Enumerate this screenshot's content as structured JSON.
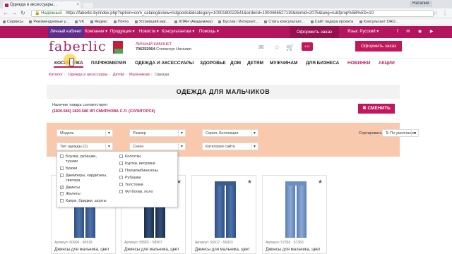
{
  "browser": {
    "tab_title": "Одежда и аксессуары...",
    "window_label": "Наталия",
    "security_label": "Надежный",
    "url": "https://faberlic.by/index.php?option=com_catalog&view=listgoods&idcategory=1000180022541&orderid=1000466527119&itemid=2075&lang=ru&fprop%5B%5D=10",
    "bookmarks": [
      "Сервисы",
      "Рекомендуемые у...",
      "VK",
      "Яндекс",
      "Почта",
      "Устревший маг...",
      "КЛАН (Академика)",
      "Буслик / Интернет...",
      "Стать консультант...",
      "Сайт лидера проекта",
      "Консультант ОАО..."
    ]
  },
  "topbar": {
    "items": [
      "Личный кабинет",
      "Компания ▾",
      "Продукция ▾",
      "Новости ▾",
      "Консультантам ▾",
      "Помощь ▾"
    ],
    "order_label": "Оформить заказ",
    "lang_label": "Язык: Русский ▾",
    "socials": "f ✉ ◉ ▶"
  },
  "header": {
    "logo": "faberlic",
    "cabinet_label": "ЛИЧНЫЙ КАБИНЕТ",
    "user_id": "706252064",
    "user_name": "Степанчук Наталия",
    "price_badge": "4,91",
    "order_button": "Оформить заказ"
  },
  "categories": [
    "КОСМЕТИКА",
    "ПАРФЮМЕРИЯ",
    "ОДЕЖДА И АКСЕССУАРЫ",
    "ЗДОРОВЬЕ",
    "ДОМ",
    "ДЕТЯМ",
    "МУЖЧИНАМ",
    "ДЛЯ БИЗНЕСА",
    "НОВИНКИ",
    "АКЦИИ"
  ],
  "breadcrumb": [
    "Каталог",
    "Одежда и аксессуары",
    "Детям",
    "Мальчикам",
    "Одежда"
  ],
  "page_title": "ОДЕЖДА ДЛЯ МАЛЬЧИКОВ",
  "availability": {
    "text": "Наличие товара соответствует",
    "store": "(1820.586) 1820.586 ИП СМИРНОВА С.Л. (СОЛИГОРСК)",
    "change_button": "✖ СМЕНИТЬ"
  },
  "filters": {
    "model": "Модель",
    "size": "Размер",
    "series": "Серия, Коллекция",
    "clothing_type": "Тип одежды (1)",
    "season": "Сезон",
    "site_category": "Категория сайта",
    "sort_label": "Сортировать",
    "sort_value": "⇅ По умолчанию"
  },
  "dropdown": {
    "left": [
      {
        "label": "Блузки, рубашки,",
        "label2": "туники",
        "checked": false
      },
      {
        "label": "Брюки",
        "checked": false
      },
      {
        "label": "Джемперы, кардиганы,",
        "label2": "свитера",
        "checked": false
      },
      {
        "label": "Джинсы",
        "checked": true
      },
      {
        "label": "Жилеты",
        "checked": false
      },
      {
        "label": "Капри, бриджи, шорты",
        "checked": false
      }
    ],
    "right": [
      {
        "label": "Колготки",
        "checked": false
      },
      {
        "label": "Куртки, ветровки",
        "checked": false
      },
      {
        "label": "Полукомбинезоны",
        "checked": false
      },
      {
        "label": "Рубашки",
        "checked": false
      },
      {
        "label": "Толстовки",
        "checked": false
      },
      {
        "label": "Футболки, поло",
        "checked": false
      }
    ]
  },
  "products": [
    {
      "article": "Артикул: 60906 - 60918",
      "name": "Джинсы для мальчика, цвет"
    },
    {
      "article": "Артикул: 58901 - 58907",
      "name": "Джинсы для мальчика, цвет"
    },
    {
      "article": "Артикул: 56917 - 56923",
      "name": "Джинсы для мальчика, цвет"
    },
    {
      "article": "Артикул: 57355 - 57363",
      "name": "Джинсы для мальчика, цвет"
    }
  ]
}
